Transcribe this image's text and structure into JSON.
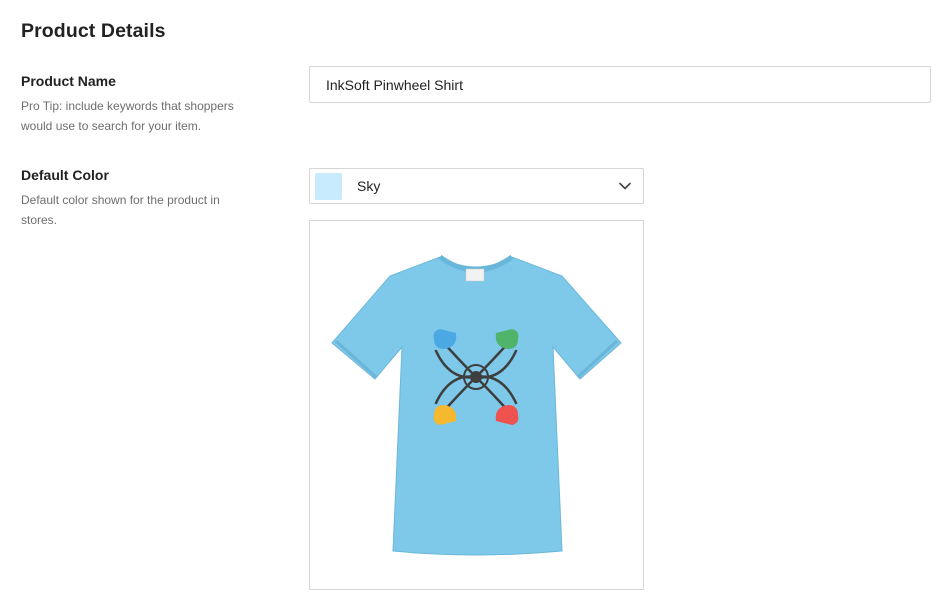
{
  "page": {
    "title": "Product Details"
  },
  "product_name": {
    "label": "Product Name",
    "help": "Pro Tip: include keywords that shoppers would use to search for your item.",
    "value": "InkSoft Pinwheel Shirt"
  },
  "default_color": {
    "label": "Default Color",
    "help": "Default color shown for the product in stores.",
    "selected": "Sky",
    "swatch_color": "#c8ecfd",
    "icon": "chevron-down-icon"
  },
  "preview": {
    "shirt_color": "#7ec9ea",
    "logo_colors": {
      "blue": "#4aa8e2",
      "green": "#4fb36a",
      "yellow": "#f6b82e",
      "red": "#ef5350",
      "outline": "#3e3e3e"
    }
  }
}
